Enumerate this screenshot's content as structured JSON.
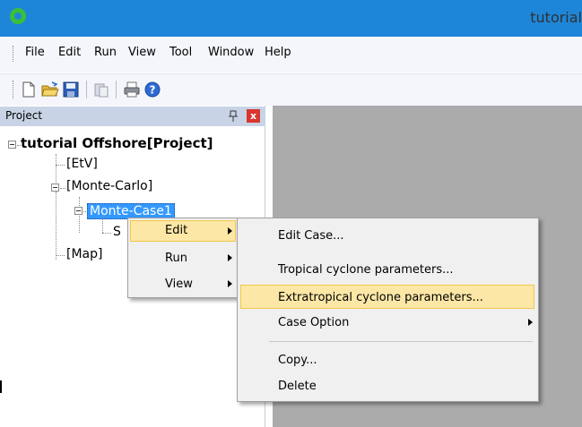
{
  "window": {
    "title": "tutorial"
  },
  "menubar": {
    "items": [
      "File",
      "Edit",
      "Run",
      "View",
      "Tool",
      "Window",
      "Help"
    ]
  },
  "toolbar": {
    "icons": [
      "new-file-icon",
      "open-folder-icon",
      "save-icon",
      "paste-icon",
      "print-icon",
      "help-icon"
    ]
  },
  "panel": {
    "title": "Project",
    "pin_glyph": "ᵩ",
    "close_glyph": "x"
  },
  "tree": {
    "root": "tutorial Offshore[Project]",
    "etv": "[EtV]",
    "monte_carlo": "[Monte-Carlo]",
    "monte_case": "Monte-Case1",
    "child_partial": "S",
    "map": "[Map]"
  },
  "context_menu": {
    "items": [
      "Edit",
      "Run",
      "View"
    ]
  },
  "submenu": {
    "items": [
      "Edit Case...",
      "Tropical cyclone parameters...",
      "Extratropical cyclone parameters...",
      "Case Option",
      "Copy...",
      "Delete"
    ]
  },
  "colors": {
    "titlebar": "#1e86d8",
    "selection": "#3399ff",
    "highlight": "#fce7a6",
    "workspace": "#ababab"
  }
}
